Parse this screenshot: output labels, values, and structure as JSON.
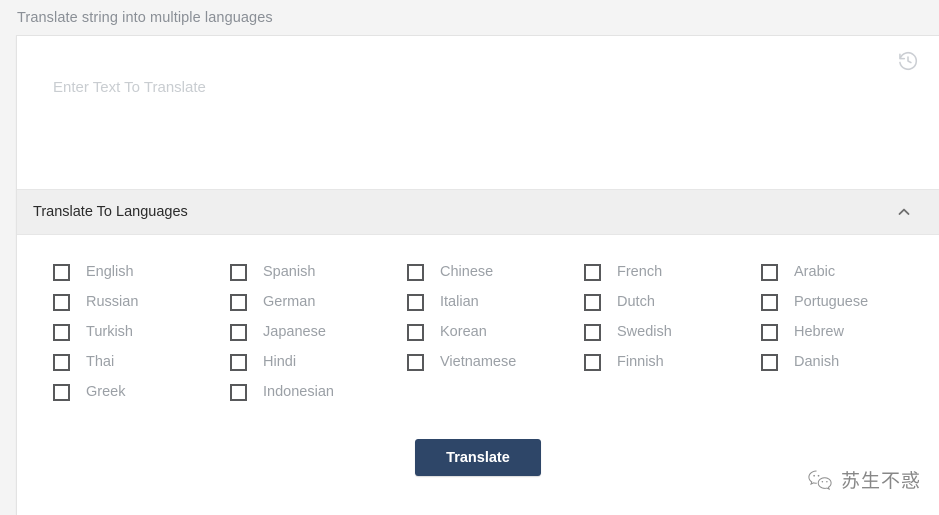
{
  "page": {
    "heading": "Translate string into multiple languages"
  },
  "input": {
    "placeholder": "Enter Text To Translate",
    "value": "",
    "history_icon": "history-icon"
  },
  "panel": {
    "title": "Translate To Languages",
    "collapse_icon": "chevron-up-icon",
    "expanded": true
  },
  "languages": [
    {
      "label": "English",
      "checked": false
    },
    {
      "label": "Spanish",
      "checked": false
    },
    {
      "label": "Chinese",
      "checked": false
    },
    {
      "label": "French",
      "checked": false
    },
    {
      "label": "Arabic",
      "checked": false
    },
    {
      "label": "Russian",
      "checked": false
    },
    {
      "label": "German",
      "checked": false
    },
    {
      "label": "Italian",
      "checked": false
    },
    {
      "label": "Dutch",
      "checked": false
    },
    {
      "label": "Portuguese",
      "checked": false
    },
    {
      "label": "Turkish",
      "checked": false
    },
    {
      "label": "Japanese",
      "checked": false
    },
    {
      "label": "Korean",
      "checked": false
    },
    {
      "label": "Swedish",
      "checked": false
    },
    {
      "label": "Hebrew",
      "checked": false
    },
    {
      "label": "Thai",
      "checked": false
    },
    {
      "label": "Hindi",
      "checked": false
    },
    {
      "label": "Vietnamese",
      "checked": false
    },
    {
      "label": "Finnish",
      "checked": false
    },
    {
      "label": "Danish",
      "checked": false
    },
    {
      "label": "Greek",
      "checked": false
    },
    {
      "label": "Indonesian",
      "checked": false
    },
    {
      "label": "",
      "checked": false
    },
    {
      "label": "",
      "checked": false
    },
    {
      "label": "",
      "checked": false
    }
  ],
  "submit": {
    "label": "Translate"
  },
  "watermark": {
    "text": "苏生不惑",
    "icon": "wechat-icon"
  },
  "colors": {
    "page_background": "#f4f4f4",
    "card_background": "#ffffff",
    "panel_header_background": "#efefef",
    "button_background": "#2e4668",
    "button_text": "#ffffff",
    "label_text": "#9ba0a6",
    "heading_text": "#8a8f96",
    "checkbox_border": "#58595b"
  }
}
